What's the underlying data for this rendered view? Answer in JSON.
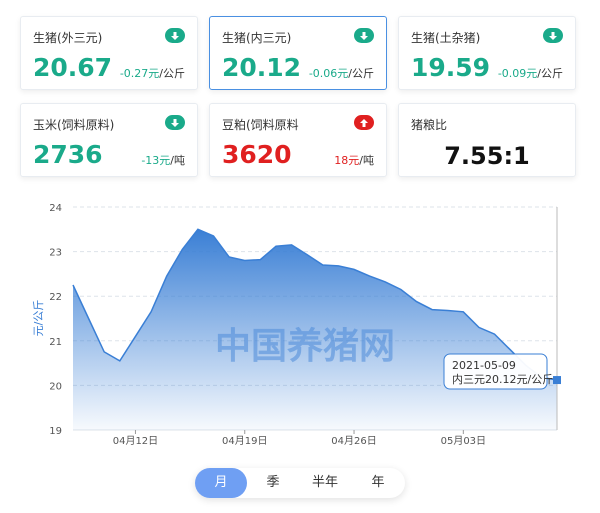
{
  "cards": [
    {
      "name": "生猪(外三元)",
      "value": "20.67",
      "change": "-0.27元",
      "unit": "/公斤",
      "direction": "down"
    },
    {
      "name": "生猪(内三元)",
      "value": "20.12",
      "change": "-0.06元",
      "unit": "/公斤",
      "direction": "down"
    },
    {
      "name": "生猪(土杂猪)",
      "value": "19.59",
      "change": "-0.09元",
      "unit": "/公斤",
      "direction": "down"
    },
    {
      "name": "玉米(饲料原料)",
      "value": "2736",
      "change": "-13元",
      "unit": "/吨",
      "direction": "down"
    },
    {
      "name": "豆粕(饲料原料",
      "value": "3620",
      "change": "18元",
      "unit": "/吨",
      "direction": "up"
    },
    {
      "name": "猪粮比",
      "value": "7.55:1"
    }
  ],
  "colors": {
    "down": "#1aaa8a",
    "up": "#e02020",
    "line": "#3a7fd5"
  },
  "chart_data": {
    "type": "area",
    "ylabel": "元/公斤",
    "ylim": [
      19,
      24
    ],
    "yticks": [
      "19",
      "20",
      "21",
      "22",
      "23",
      "24"
    ],
    "xticks": [
      "04月12日",
      "04月19日",
      "04月26日",
      "05月03日"
    ],
    "xtick_days": [
      4,
      11,
      18,
      25
    ],
    "watermark": "中国养猪网",
    "x_dates": [
      "04-08",
      "04-09",
      "04-10",
      "04-11",
      "04-12",
      "04-13",
      "04-14",
      "04-15",
      "04-16",
      "04-17",
      "04-18",
      "04-19",
      "04-20",
      "04-21",
      "04-22",
      "04-23",
      "04-24",
      "04-25",
      "04-26",
      "04-27",
      "04-28",
      "04-29",
      "04-30",
      "05-01",
      "05-02",
      "05-03",
      "05-04",
      "05-05",
      "05-06",
      "05-07",
      "05-08",
      "05-09"
    ],
    "values": [
      22.25,
      21.5,
      20.75,
      20.55,
      21.1,
      21.65,
      22.45,
      23.05,
      23.5,
      23.35,
      22.88,
      22.8,
      22.82,
      23.12,
      23.15,
      22.93,
      22.7,
      22.68,
      22.6,
      22.45,
      22.32,
      22.15,
      21.88,
      21.7,
      21.68,
      21.65,
      21.3,
      21.15,
      20.8,
      20.45,
      20.18,
      20.12
    ],
    "tooltip": {
      "date": "2021-05-09",
      "text": "内三元20.12元/公斤"
    }
  },
  "tabs": [
    "月",
    "季",
    "半年",
    "年"
  ],
  "selected_tab": "月"
}
